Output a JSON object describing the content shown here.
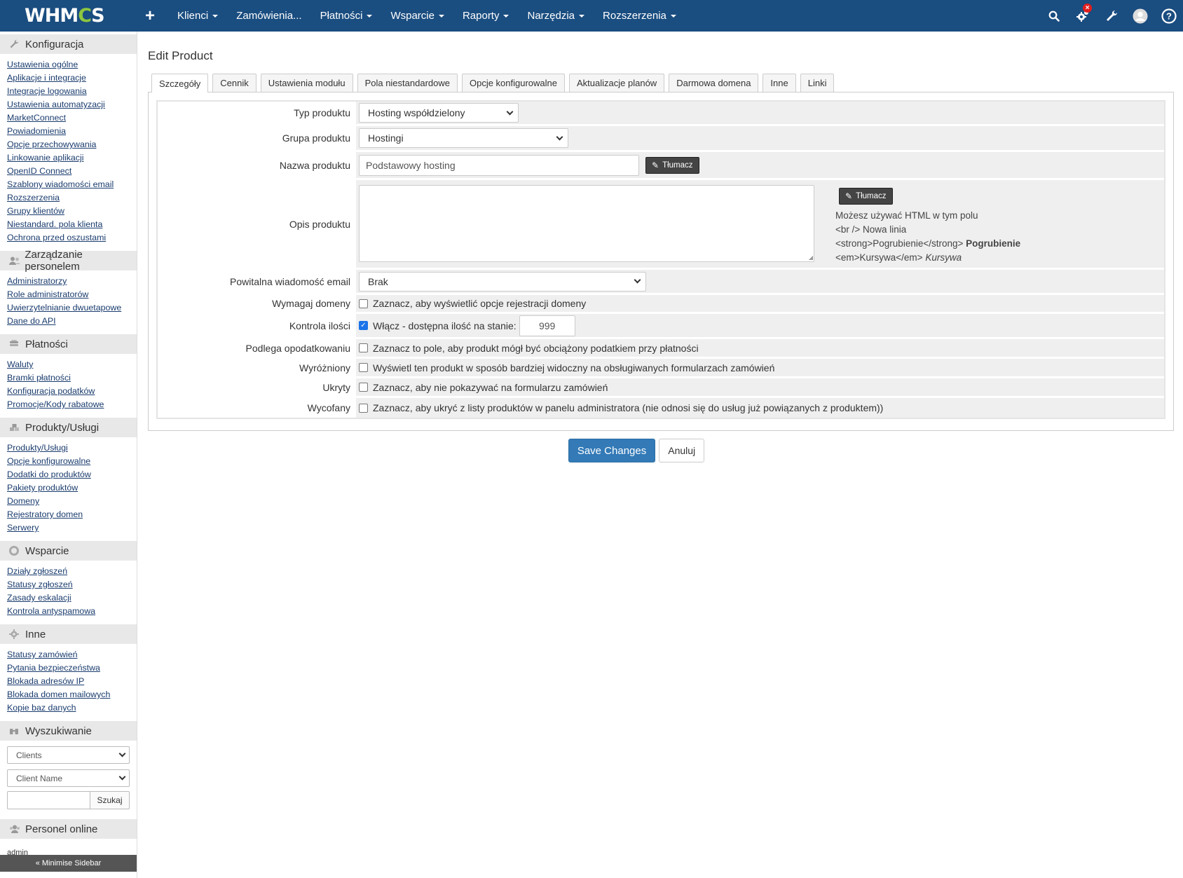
{
  "brand": {
    "logo_pre": "WHM",
    "logo_gear": "C",
    "logo_post": "S"
  },
  "topnav": {
    "items": [
      {
        "label": "Klienci",
        "caret": true
      },
      {
        "label": "Zamówienia...",
        "caret": false
      },
      {
        "label": "Płatności",
        "caret": true
      },
      {
        "label": "Wsparcie",
        "caret": true
      },
      {
        "label": "Raporty",
        "caret": true
      },
      {
        "label": "Narzędzia",
        "caret": true
      },
      {
        "label": "Rozszerzenia",
        "caret": true
      }
    ],
    "icons": [
      "add-icon",
      "search-icon",
      "cogs-icon",
      "wrench-icon",
      "user-avatar-icon",
      "help-icon"
    ],
    "alert_badge": "×"
  },
  "sidebar": {
    "sections": [
      {
        "title": "Konfiguracja",
        "icon": "wrench-icon",
        "links": [
          "Ustawienia ogólne",
          "Aplikacje i integracje",
          "Integracje logowania",
          "Ustawienia automatyzacji",
          "MarketConnect",
          "Powiadomienia",
          "Opcje przechowywania",
          "Linkowanie aplikacji",
          "OpenID Connect",
          "Szablony wiadomości email",
          "Rozszerzenia",
          "Grupy klientów",
          "Niestandard. pola klienta",
          "Ochrona przed oszustami"
        ]
      },
      {
        "title": "Zarządzanie personelem",
        "icon": "users-icon",
        "links": [
          "Administratorzy",
          "Role administratorów",
          "Uwierzytelnianie dwuetapowe",
          "Dane do API"
        ]
      },
      {
        "title": "Płatności",
        "icon": "money-icon",
        "links": [
          "Waluty",
          "Bramki płatności",
          "Konfiguracja podatków",
          "Promocje/Kody rabatowe"
        ]
      },
      {
        "title": "Produkty/Usługi",
        "icon": "cubes-icon",
        "links": [
          "Produkty/Usługi",
          "Opcje konfigurowalne",
          "Dodatki do produktów",
          "Pakiety produktów",
          "Domeny",
          "Rejestratory domen",
          "Serwery"
        ]
      },
      {
        "title": "Wsparcie",
        "icon": "lifebuoy-icon",
        "links": [
          "Działy zgłoszeń",
          "Statusy zgłoszeń",
          "Zasady eskalacji",
          "Kontrola antyspamowa"
        ]
      },
      {
        "title": "Inne",
        "icon": "cog-icon",
        "links": [
          "Statusy zamówień",
          "Pytania bezpieczeństwa",
          "Blokada adresów IP",
          "Blokada domen mailowych",
          "Kopie baz danych"
        ]
      }
    ],
    "search": {
      "title": "Wyszukiwanie",
      "icon": "binoculars-icon",
      "type_value": "Clients",
      "field_value": "Client Name",
      "query_value": "",
      "button": "Szukaj"
    },
    "online": {
      "title": "Personel online",
      "icon": "users-icon",
      "users": "admin"
    },
    "minimise": "« Minimise Sidebar"
  },
  "page": {
    "title": "Edit Product",
    "tabs": [
      "Szczegóły",
      "Cennik",
      "Ustawienia modułu",
      "Pola niestandardowe",
      "Opcje konfigurowalne",
      "Aktualizacje planów",
      "Darmowa domena",
      "Inne",
      "Linki"
    ],
    "active_tab": "Szczegóły"
  },
  "form": {
    "product_type": {
      "label": "Typ produktu",
      "value": "Hosting współdzielony"
    },
    "product_group": {
      "label": "Grupa produktu",
      "value": "Hostingi"
    },
    "product_name": {
      "label": "Nazwa produktu",
      "value": "Podstawowy hosting",
      "translate": "Tłumacz"
    },
    "product_description": {
      "label": "Opis produktu",
      "value": "",
      "translate": "Tłumacz",
      "help_line1": "Możesz używać HTML w tym polu",
      "help_line2": "<br /> Nowa linia",
      "help_line3_code": "<strong>Pogrubienie</strong>",
      "help_line3_demo": "Pogrubienie",
      "help_line4_code": "<em>Kursywa</em>",
      "help_line4_demo": "Kursywa"
    },
    "welcome_email": {
      "label": "Powitalna wiadomość email",
      "value": "Brak"
    },
    "require_domain": {
      "label": "Wymagaj domeny",
      "checked": false,
      "text": "Zaznacz, aby wyświetlić opcje rejestracji domeny"
    },
    "stock_control": {
      "label": "Kontrola ilości",
      "checked": true,
      "text": "Włącz - dostępna ilość na stanie:",
      "quantity": "999"
    },
    "taxable": {
      "label": "Podlega opodatkowaniu",
      "checked": false,
      "text": "Zaznacz to pole, aby produkt mógł być obciążony podatkiem przy płatności"
    },
    "featured": {
      "label": "Wyróżniony",
      "checked": false,
      "text": "Wyświetl ten produkt w sposób bardziej widoczny na obsługiwanych formularzach zamówień"
    },
    "hidden": {
      "label": "Ukryty",
      "checked": false,
      "text": "Zaznacz, aby nie pokazywać na formularzu zamówień"
    },
    "retired": {
      "label": "Wycofany",
      "checked": false,
      "text": "Zaznacz, aby ukryć z listy produktów w panelu administratora (nie odnosi się do usług już powiązanych z produktem))"
    }
  },
  "actions": {
    "save": "Save Changes",
    "cancel": "Anuluj"
  },
  "colors": {
    "topbar": "#1a4d80",
    "logo_gear": "#8dc63f",
    "primary": "#337ab7",
    "badge": "#e21e1e"
  }
}
